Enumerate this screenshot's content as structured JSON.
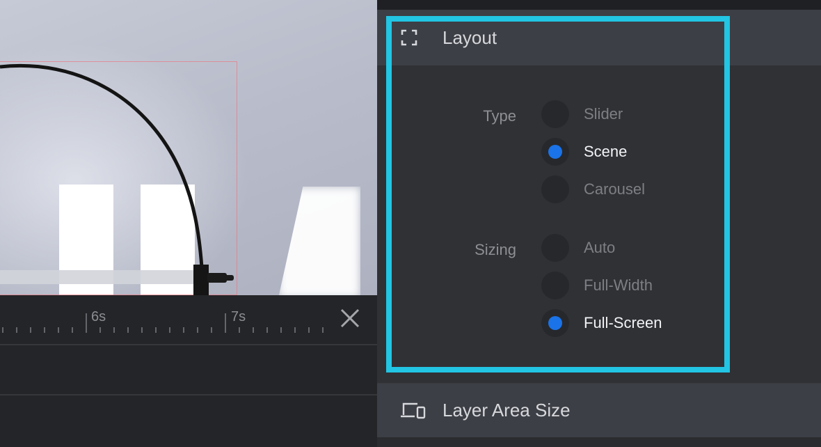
{
  "timeline": {
    "ticks": [
      "6s",
      "7s"
    ]
  },
  "panel": {
    "layout": {
      "title": "Layout",
      "type_label": "Type",
      "type_options": [
        {
          "label": "Slider",
          "selected": false
        },
        {
          "label": "Scene",
          "selected": true
        },
        {
          "label": "Carousel",
          "selected": false
        }
      ],
      "sizing_label": "Sizing",
      "sizing_options": [
        {
          "label": "Auto",
          "selected": false
        },
        {
          "label": "Full-Width",
          "selected": false
        },
        {
          "label": "Full-Screen",
          "selected": true
        }
      ]
    },
    "layer_area": {
      "title": "Layer Area Size"
    }
  },
  "colors": {
    "accent": "#1a73e8",
    "highlight": "#22c5e3",
    "panel_bg": "#303135",
    "header_bg": "#3d3f46"
  },
  "icons": {
    "layout": "fullscreen-corners-icon",
    "layer_area": "devices-icon",
    "close": "close-icon"
  }
}
